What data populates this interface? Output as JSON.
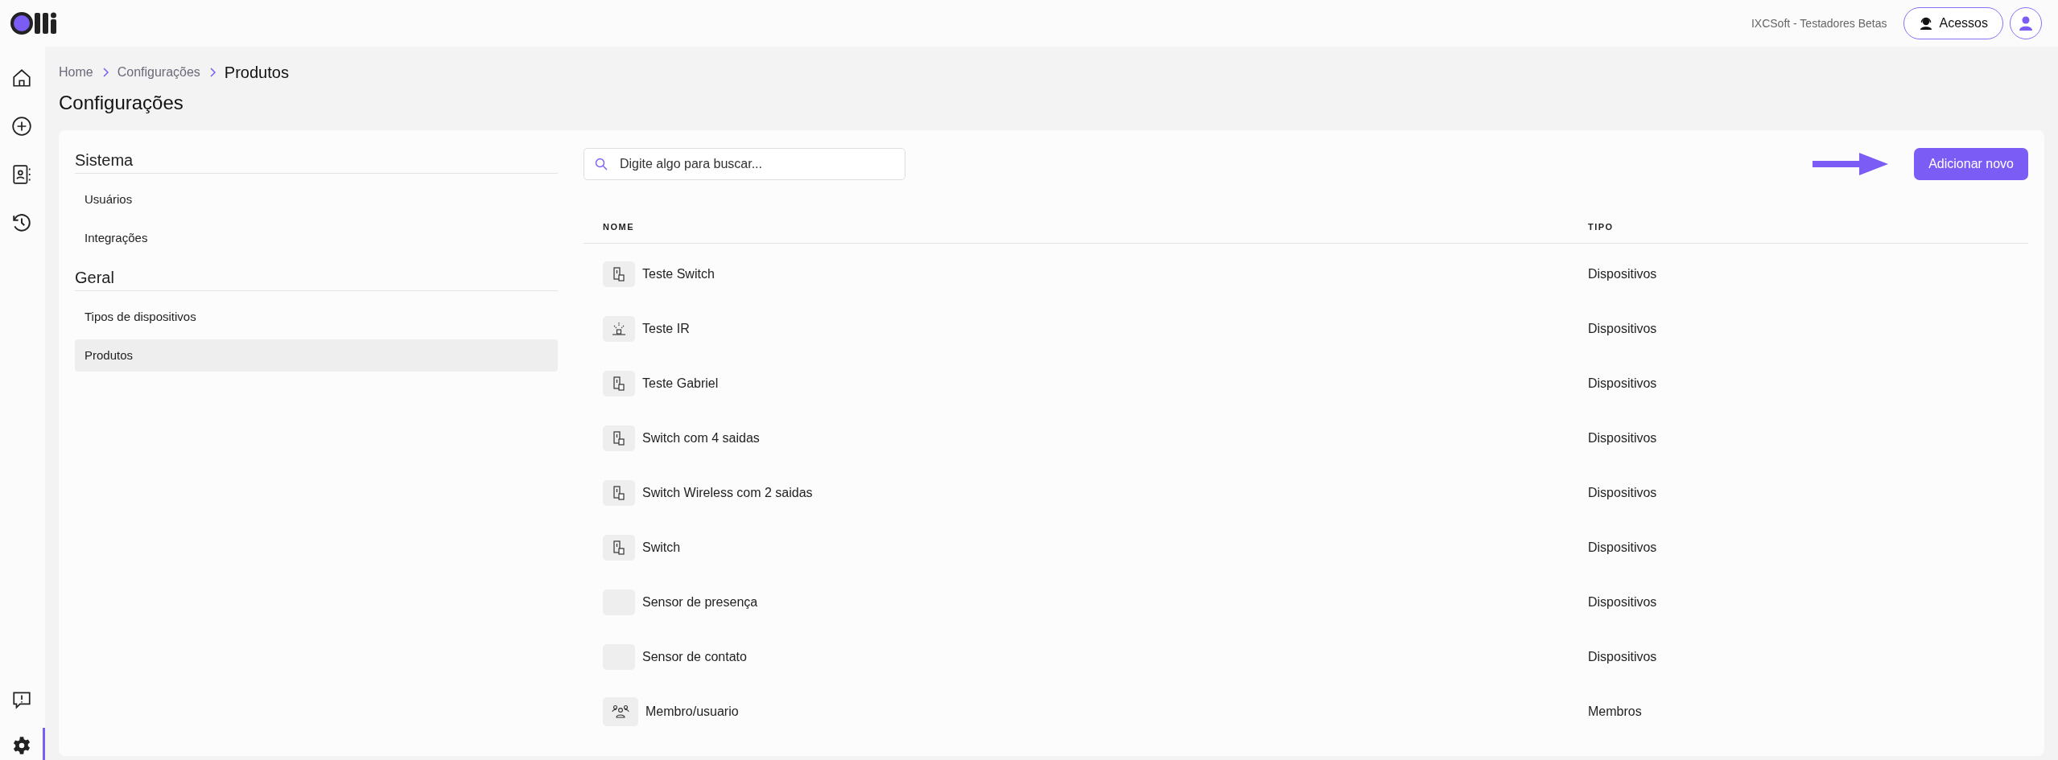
{
  "header": {
    "company": "IXCSoft - Testadores Betas",
    "access_button": "Acessos"
  },
  "rail": {
    "top": [
      {
        "kind": "home",
        "selected": false
      },
      {
        "kind": "add",
        "selected": false
      },
      {
        "kind": "contacts",
        "selected": false
      },
      {
        "kind": "history",
        "selected": false
      }
    ],
    "bottom": [
      {
        "kind": "feedback",
        "selected": false
      },
      {
        "kind": "settings",
        "selected": true
      }
    ]
  },
  "breadcrumb": [
    {
      "label": "Home",
      "current": false
    },
    {
      "label": "Configurações",
      "current": false
    },
    {
      "label": "Produtos",
      "current": true
    }
  ],
  "page_title": "Configurações",
  "settings_menu": [
    {
      "heading": "Sistema",
      "items": [
        {
          "label": "Usuários",
          "selected": false
        },
        {
          "label": "Integrações",
          "selected": false
        }
      ]
    },
    {
      "heading": "Geral",
      "items": [
        {
          "label": "Tipos de dispositivos",
          "selected": false
        },
        {
          "label": "Produtos",
          "selected": true
        }
      ]
    }
  ],
  "search": {
    "placeholder": "Digite algo para buscar..."
  },
  "add_button": "Adicionar novo",
  "table": {
    "columns": [
      "NOME",
      "TIPO"
    ],
    "rows": [
      {
        "kind": "switch",
        "name": "Teste Switch",
        "type": "Dispositivos"
      },
      {
        "kind": "ir",
        "name": "Teste IR",
        "type": "Dispositivos"
      },
      {
        "kind": "switch",
        "name": "Teste Gabriel",
        "type": "Dispositivos"
      },
      {
        "kind": "switch",
        "name": "Switch com 4 saidas",
        "type": "Dispositivos"
      },
      {
        "kind": "switch",
        "name": "Switch Wireless com 2 saidas",
        "type": "Dispositivos"
      },
      {
        "kind": "switch",
        "name": "Switch",
        "type": "Dispositivos"
      },
      {
        "kind": "none",
        "name": "Sensor de presença",
        "type": "Dispositivos"
      },
      {
        "kind": "none",
        "name": "Sensor de contato",
        "type": "Dispositivos"
      },
      {
        "kind": "members",
        "name": "Membro/usuario",
        "type": "Membros"
      }
    ]
  }
}
